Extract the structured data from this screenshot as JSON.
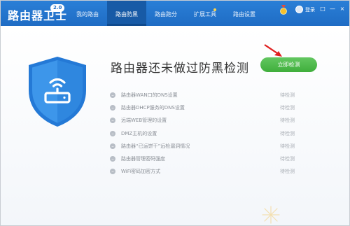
{
  "app": {
    "title": "路由器卫士",
    "version": "2.0"
  },
  "tabs": [
    {
      "label": "我的路由"
    },
    {
      "label": "路由防黑"
    },
    {
      "label": "路由跑分"
    },
    {
      "label": "扩展工具"
    },
    {
      "label": "路由设置"
    }
  ],
  "header": {
    "login_label": "登录",
    "win_restore": "□",
    "win_minimize": "—",
    "win_close": "×"
  },
  "main": {
    "headline": "路由器还未做过防黑检测",
    "detect_button": "立即检测",
    "checks": [
      {
        "label": "路由器WAN口的DNS设置",
        "status": "待检测"
      },
      {
        "label": "路由器DHCP服务的DNS设置",
        "status": "待检测"
      },
      {
        "label": "远端WEB管理的设置",
        "status": "待检测"
      },
      {
        "label": "DMZ主机的设置",
        "status": "待检测"
      },
      {
        "label": "路由器“已运饼干”远检漏洞情况",
        "status": "待检测"
      },
      {
        "label": "路由器管理密码强度",
        "status": "待检测"
      },
      {
        "label": "WiFi密码加密方式",
        "status": "待检测"
      }
    ]
  },
  "colors": {
    "titlebar": "#1f6cc4",
    "active_tab": "#175aa6",
    "detect_button": "#4ab847",
    "shield": "#2e86e0",
    "arrow": "#e02020"
  },
  "icons": [
    "wifi-router-icon",
    "shield-icon",
    "medal-icon",
    "avatar-icon",
    "red-arrow-icon",
    "status-dot-icon"
  ]
}
